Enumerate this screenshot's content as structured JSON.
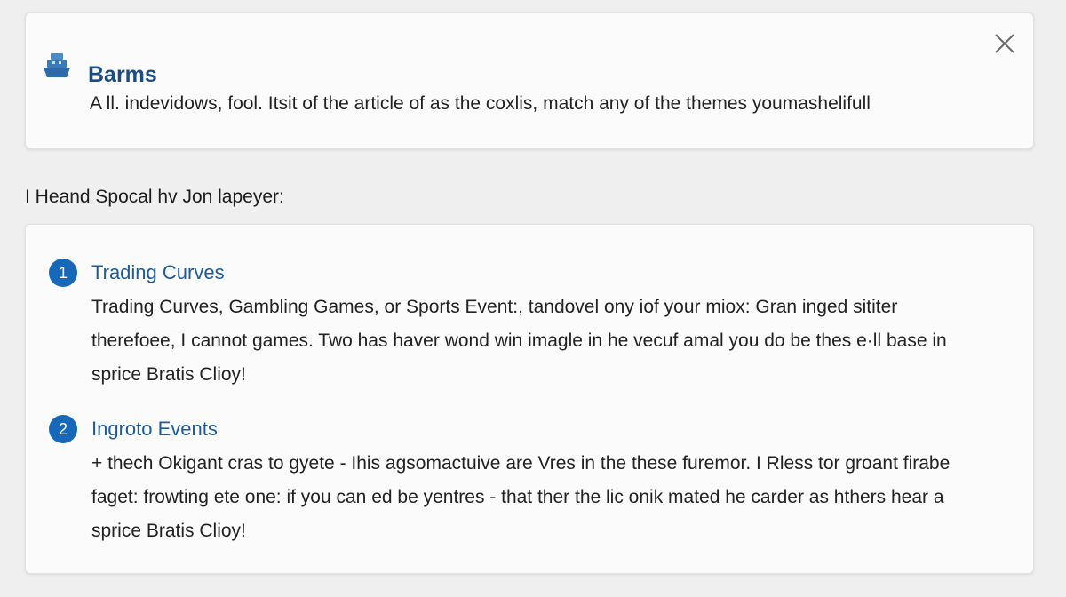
{
  "banner": {
    "icon": "ship-icon",
    "title": "Barms",
    "description": "A ll. indevidows, fool. Itsit of the article of as the coxlis, match any of the  themes youmashelifull",
    "close_icon": "close-icon"
  },
  "section": {
    "heading": "I Heand Spocal hv Jon lapeyer:"
  },
  "items": [
    {
      "number": "1",
      "title": "Trading Curves",
      "lines": [
        "Trading Curves, Gambling Games, or Sports Event:, tandovel ony iof your miox: Gran inged sititer",
        "therefoee, I cannot games. Two has haver wond win imagle in he vecuf amal you do be thes e·ll base in",
        "sprice Bratis Clioy!"
      ]
    },
    {
      "number": "2",
      "title": "Ingroto Events",
      "lines": [
        "+ thech Okigant cras to gyete - Ihis agsomactuive are Vres in the these furemor. I Rless tor groant firabe",
        "faget: frowting ete one:  if you can ed be yentres - that ther the lic onik mated he carder as hthers hear a",
        "sprice Bratis Clioy!"
      ]
    }
  ],
  "colors": {
    "accent": "#1768b8",
    "title_blue": "#1b4d80",
    "link_blue": "#1b5b9c",
    "background": "#efefef",
    "card": "#fbfbfb"
  }
}
